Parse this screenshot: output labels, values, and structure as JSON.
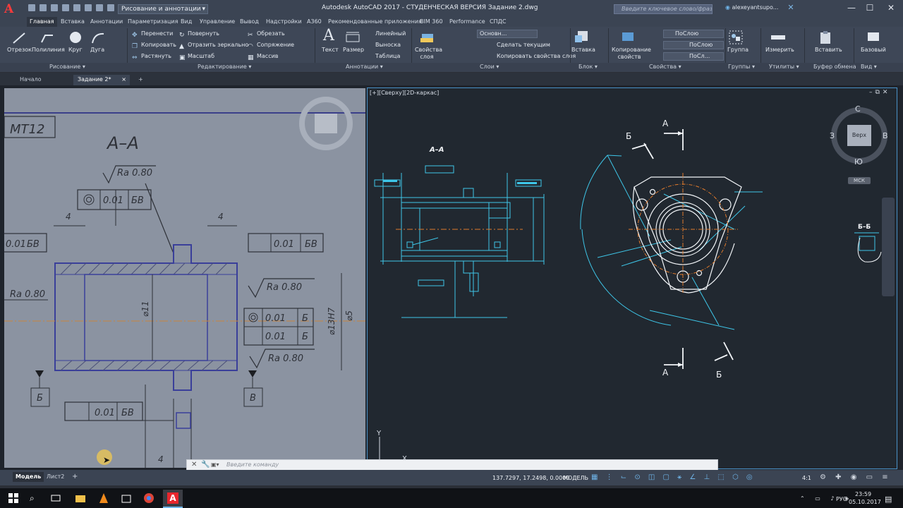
{
  "app": {
    "logo": "A",
    "workspace": "Рисование и аннотации",
    "window_title": "Autodesk AutoCAD 2017 - СТУДЕНЧЕСКАЯ ВЕРСИЯ     Задание 2.dwg",
    "search_placeholder": "Введите ключевое слово/фразу",
    "user": "alexeyantsupo..."
  },
  "ribbon_tabs": [
    "Главная",
    "Вставка",
    "Аннотации",
    "Параметризация",
    "Вид",
    "Управление",
    "Вывод",
    "Надстройки",
    "A360",
    "Рекомендованные приложения",
    "BIM 360",
    "Performance",
    "СПДС"
  ],
  "draw_tools": [
    "Отрезок",
    "Полилиния",
    "Круг",
    "Дуга"
  ],
  "edit_tools": [
    "Перенести",
    "Копировать",
    "Растянуть",
    "Повернуть",
    "Отразить зеркально",
    "Масштаб",
    "Обрезать",
    "Сопряжение",
    "Массив"
  ],
  "annot_tools": [
    "Текст",
    "Размер",
    "Линейный",
    "Выноска",
    "Таблица"
  ],
  "layer_tools": [
    "Свойства слоя",
    "Основн...",
    "Сделать текущим",
    "Копировать свойства слоя"
  ],
  "block_tools": [
    "Вставка"
  ],
  "prop_tools": [
    "Копирование свойств",
    "ПоСлою",
    "ПоСлою",
    "ПоСл..."
  ],
  "group_tools": [
    "Группа"
  ],
  "util_tools": [
    "Измерить"
  ],
  "clip_tools": [
    "Вставить"
  ],
  "view_tools": [
    "Базовый"
  ],
  "panel_labels": [
    "Рисование",
    "Редактирование",
    "Аннотации",
    "Слои",
    "Блок",
    "Свойства",
    "Группы",
    "Утилиты",
    "Буфер обмена",
    "Вид"
  ],
  "doc_tabs": [
    "Начало",
    "Задание 2*"
  ],
  "viewport": {
    "label": "[+][Сверху][2D-каркас]",
    "cube_top": "Верх",
    "compass_n": "С",
    "compass_s": "Ю",
    "compass_w": "З",
    "compass_e": "В",
    "ucs": "МСК"
  },
  "ref_sketch": {
    "section": "А–А",
    "title_frag": "МТ12",
    "ra1": "Ra 0.80",
    "ra2": "Ra 0.80",
    "ra3": "Ra 0.80",
    "ra4": "Ra 0.80",
    "tol1": "0.01",
    "tol1b": "БВ",
    "tol2": "0.01",
    "tol2b": "БВ",
    "tol3": "0.01",
    "tol3b": "Б",
    "tol4": "0.01",
    "tol4b": "Б",
    "tol5": "0.01",
    "tol5b": "БВ",
    "tol6": "0.01",
    "tol6b": "БВ",
    "dim_d": "⌀11",
    "dim_h": "⌀13H7",
    "dim_5": "⌀5",
    "dim_4a": "4",
    "dim_4b": "4",
    "dim_4c": "4",
    "datum_b": "Б",
    "datum_v": "В"
  },
  "drawing": {
    "section_title": "А–А",
    "label_a1": "А",
    "label_a2": "А",
    "label_b1": "Б",
    "label_b2": "Б",
    "label_bb": "Б–Б"
  },
  "command_placeholder": "Введите команду",
  "status": {
    "tab_model": "Модель",
    "tab_sheet": "Лист2",
    "coords": "137.7297, 17.2498, 0.0000",
    "mode": "МОДЕЛЬ",
    "scale": "4:1"
  },
  "taskbar": {
    "lang": "РУС",
    "time": "23:59",
    "date": "05.10.2017"
  },
  "colors": {
    "accent": "#4a92c8",
    "cad_line": "#3ec6e8",
    "cad_center": "#e07a2b",
    "cad_white": "#f2f5f8",
    "autocad_red": "#e8262d"
  }
}
